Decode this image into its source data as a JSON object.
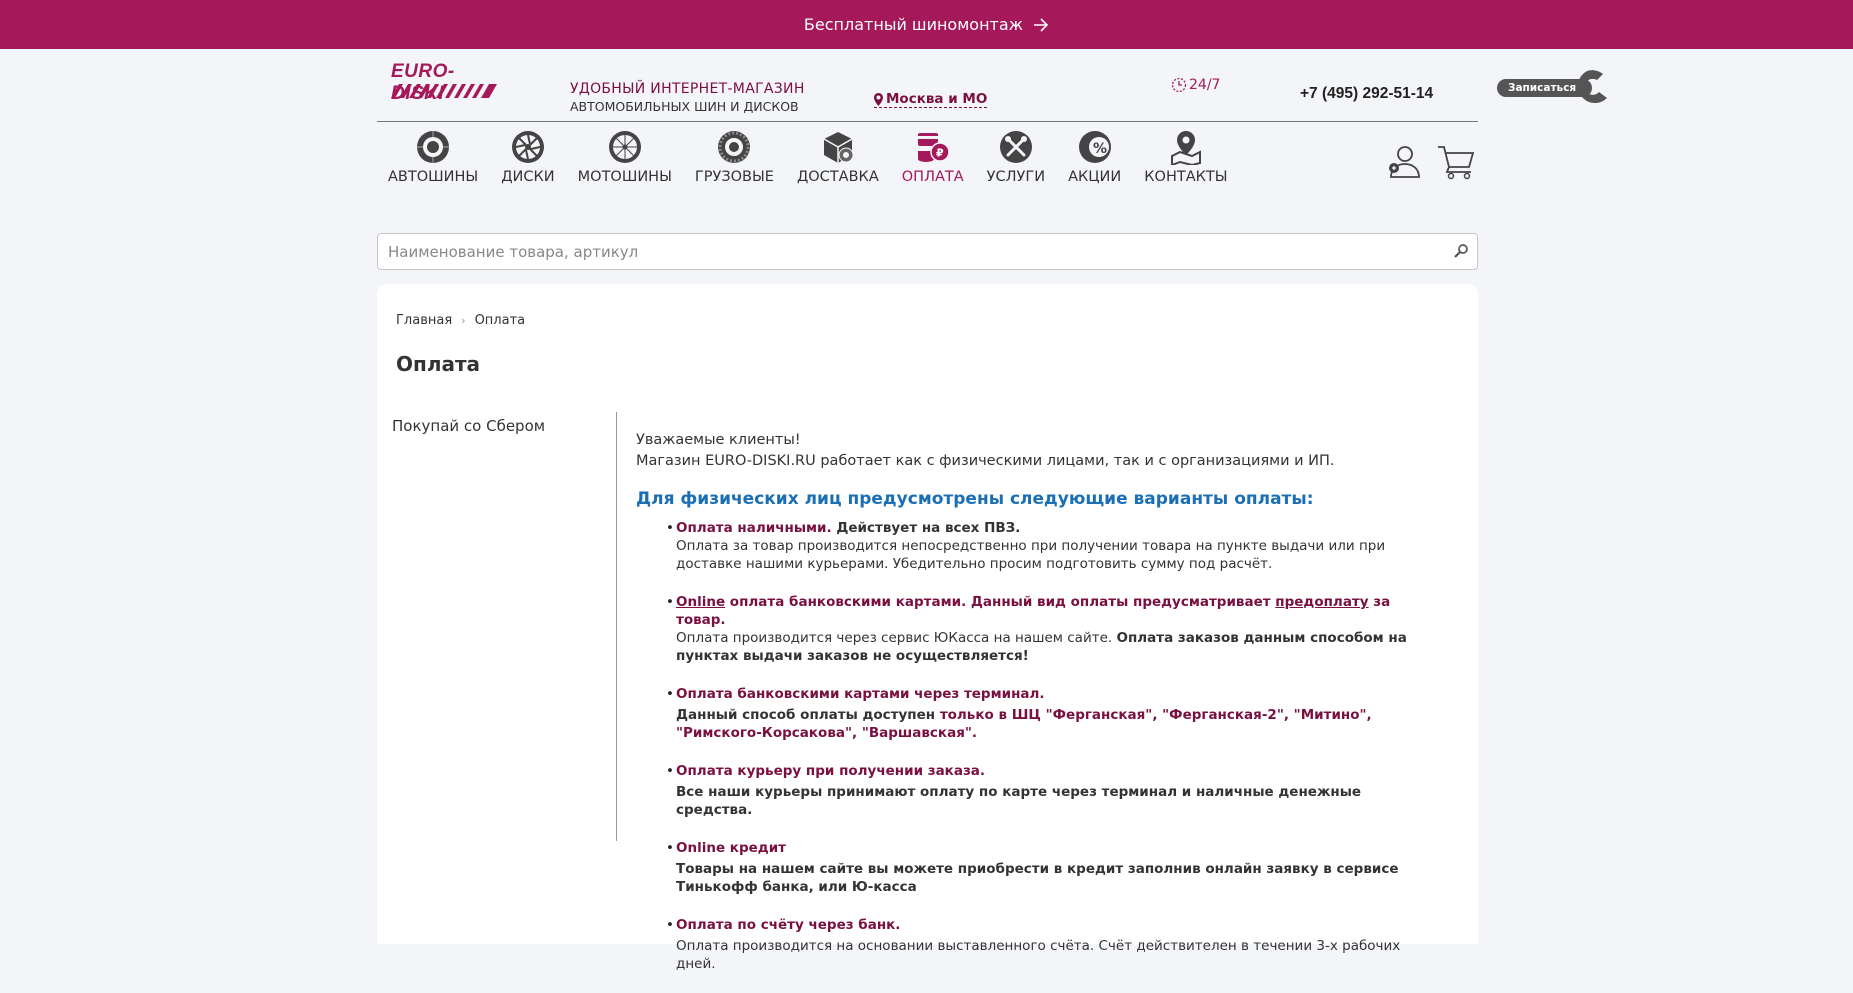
{
  "banner": {
    "text": "Бесплатный шиномонтаж"
  },
  "header": {
    "logo": "EURO-DISKI",
    "tagline_1": "УДОБНЫЙ ИНТЕРНЕТ-МАГАЗИН",
    "tagline_2": "АВТОМОБИЛЬНЫХ ШИН И ДИСКОВ",
    "city": "Москва и МО",
    "hours": "24/7",
    "phone": "+7 (495) 292-51-14",
    "signup": "Записаться"
  },
  "nav": {
    "items": [
      {
        "label": "АВТОШИНЫ",
        "icon": "tire-icon"
      },
      {
        "label": "ДИСКИ",
        "icon": "wheel-rim-icon"
      },
      {
        "label": "МОТОШИНЫ",
        "icon": "moto-tire-icon"
      },
      {
        "label": "ГРУЗОВЫЕ",
        "icon": "truck-tire-icon"
      },
      {
        "label": "ДОСТАВКА",
        "icon": "delivery-box-icon"
      },
      {
        "label": "ОПЛАТА",
        "icon": "payment-icon",
        "active": true
      },
      {
        "label": "УСЛУГИ",
        "icon": "tools-icon"
      },
      {
        "label": "АКЦИИ",
        "icon": "sale-tire-icon"
      },
      {
        "label": "КОНТАКТЫ",
        "icon": "map-pin-icon"
      }
    ]
  },
  "search": {
    "placeholder": "Наименование товара, артикул"
  },
  "breadcrumb": {
    "home": "Главная",
    "current": "Оплата"
  },
  "page": {
    "title": "Оплата",
    "side_link": "Покупай со Сбером",
    "greeting_1": "Уважаемые клиенты!",
    "greeting_2": "Магазин EURO-DISKI.RU работает как с физическими лицами, так и с организациями и ИП.",
    "subhead": "Для физических лиц предусмотрены следующие варианты оплаты:"
  },
  "options": {
    "cash": {
      "title": "Оплата наличными.",
      "title_extra": " Действует на всех ПВЗ.",
      "body": "Оплата за товар производится непосредственно при получении товара на пункте выдачи или при доставке нашими курьерами. Убедительно просим подготовить сумму под расчёт."
    },
    "online": {
      "title_a": "Online",
      "title_b": " оплата банковскими картами. Данный вид оплаты предусматривает ",
      "title_c": "предоплату",
      "title_d": " за товар.",
      "body_a": "Оплата производится через сервис ЮКасса на нашем сайте. ",
      "body_b": "Оплата заказов данным способом на пунктах выдачи заказов не осуществляется!"
    },
    "terminal": {
      "title": "Оплата банковскими картами через терминал.",
      "body_a": "Данный способ оплаты доступен ",
      "body_b": "только в ШЦ \"Ферганская\", \"Ферганская-2\", \"Митино\", \"Римского-Корсакова\", \"Варшавская\"."
    },
    "courier": {
      "title": "Оплата курьеру при получении заказа.",
      "body": "Все наши курьеры принимают оплату по карте через терминал и наличные денежные средства."
    },
    "credit": {
      "title": "Online кредит",
      "body": "Товары на нашем сайте вы можете приобрести в кредит заполнив онлайн заявку в сервисе Тинькофф банка, или Ю-касса"
    },
    "invoice": {
      "title": "Оплата по счёту через банк.",
      "body": "Оплата производится на основании выставленного счёта. Счёт действителен в течении 3-х рабочих дней."
    }
  }
}
